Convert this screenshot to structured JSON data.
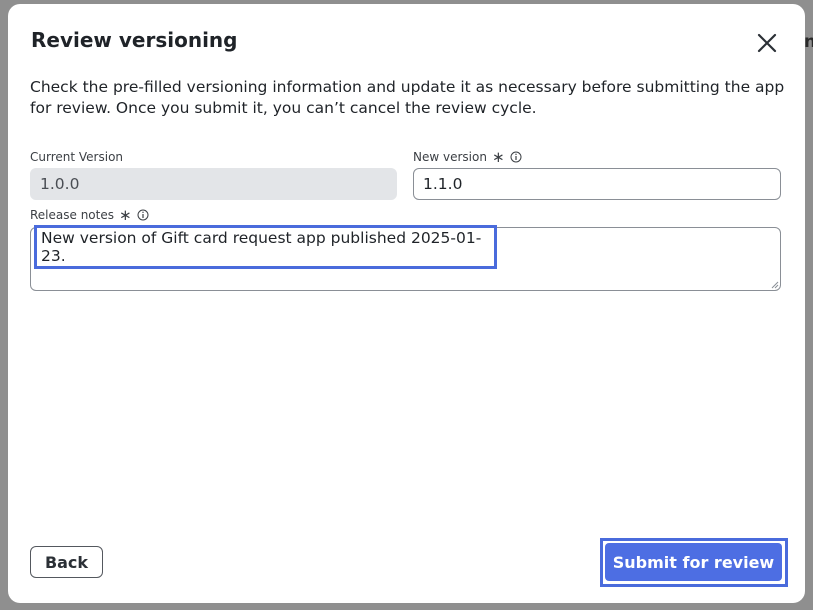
{
  "background": {
    "peek_text": "n"
  },
  "dialog": {
    "title": "Review versioning",
    "description": "Check the pre-filled versioning information and update it as necessary before submitting the app for review. Once you submit it, you can’t cancel the review cycle.",
    "current_version": {
      "label": "Current Version",
      "value": "1.0.0"
    },
    "new_version": {
      "label": "New version",
      "required_mark": "∗",
      "value": "1.1.0"
    },
    "release_notes": {
      "label": "Release notes",
      "required_mark": "∗",
      "value": "New version of Gift card request app published 2025-01-23."
    },
    "buttons": {
      "back": "Back",
      "submit": "Submit for review"
    }
  },
  "icons": [
    "close-icon",
    "info-icon",
    "resize-grip-icon"
  ],
  "colors": {
    "accent": "#4d6ee3",
    "highlight": "#4a6bdc",
    "readonly_bg": "#e3e5e8"
  }
}
